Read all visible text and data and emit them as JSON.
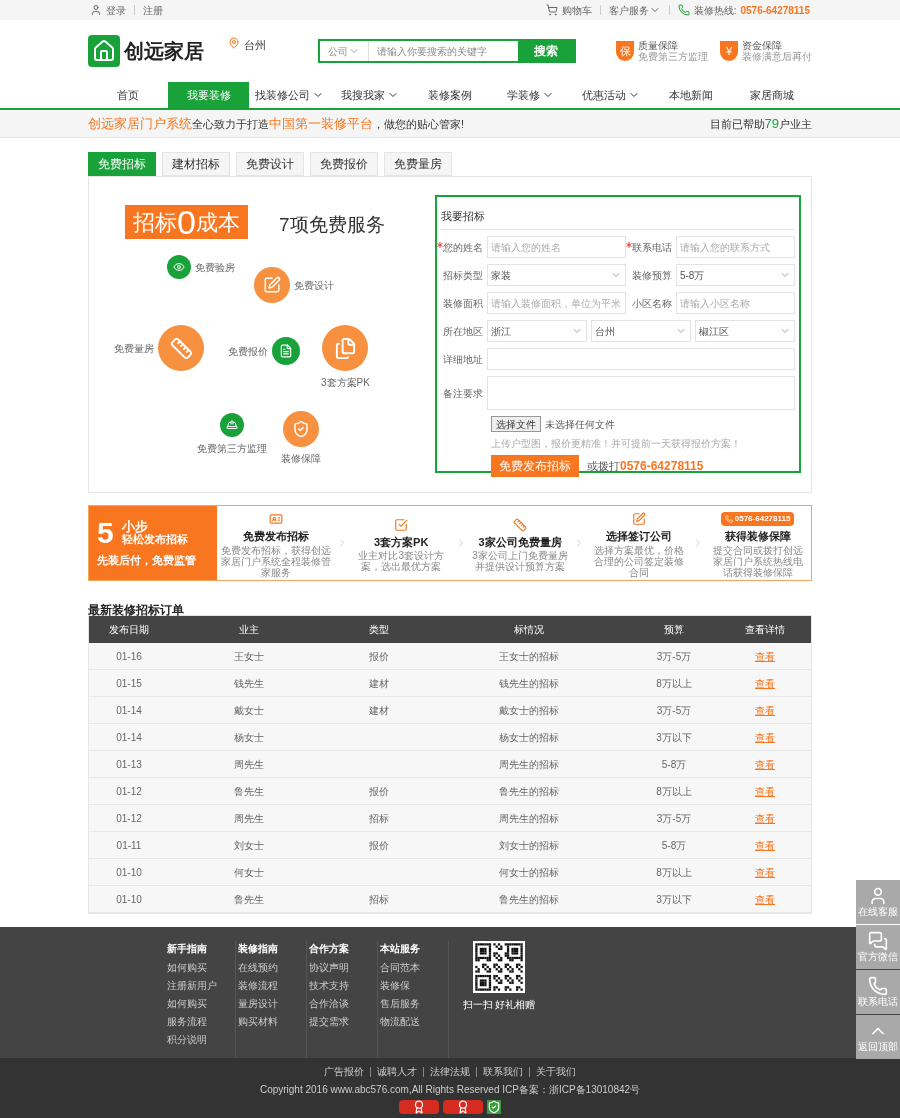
{
  "top_bar": {
    "login": "登录",
    "register": "注册",
    "cart": "购物车",
    "customer_service": "客户服务",
    "hotline_label": "装修热线:",
    "hotline": "0576-64278115"
  },
  "header": {
    "logo": "创远家居",
    "city": "台州",
    "search": {
      "category": "公司",
      "placeholder": "请输入你要搜索的关键字",
      "button": "搜索"
    },
    "guarantees": [
      {
        "badge": "保",
        "title": "质量保障",
        "subtitle": "免费第三方监理"
      },
      {
        "badge": "¥",
        "title": "资金保障",
        "subtitle": "装修满意后再付"
      }
    ]
  },
  "nav": [
    {
      "label": "首页",
      "selected": false,
      "dropdown": false
    },
    {
      "label": "我要装修",
      "selected": true,
      "dropdown": false
    },
    {
      "label": "找装修公司",
      "selected": false,
      "dropdown": true
    },
    {
      "label": "我搜我家",
      "selected": false,
      "dropdown": true
    },
    {
      "label": "装修案例",
      "selected": false,
      "dropdown": false
    },
    {
      "label": "学装修",
      "selected": false,
      "dropdown": true
    },
    {
      "label": "优惠活动",
      "selected": false,
      "dropdown": true
    },
    {
      "label": "本地新闻",
      "selected": false,
      "dropdown": false
    },
    {
      "label": "家居商城",
      "selected": false,
      "dropdown": false
    }
  ],
  "slogan": {
    "segments": [
      {
        "text": "创远家居门户系统",
        "highlight": true
      },
      {
        "text": "全心致力于打造",
        "highlight": false
      },
      {
        "text": "中国第一装修平台",
        "highlight": true
      },
      {
        "text": "，做您的贴心管家!",
        "highlight": false
      }
    ],
    "helped_prefix": "目前已帮助",
    "helped_count": "79",
    "helped_suffix": "户业主"
  },
  "tabs": [
    {
      "label": "免费招标",
      "selected": true
    },
    {
      "label": "建材招标",
      "selected": false
    },
    {
      "label": "免费设计",
      "selected": false
    },
    {
      "label": "免费报价",
      "selected": false
    },
    {
      "label": "免费量房",
      "selected": false
    }
  ],
  "services": {
    "banner_prefix": "招标",
    "banner_zero": "0",
    "banner_suffix": "成本",
    "title": "7项免费服务",
    "items": [
      {
        "label": "免费验房",
        "color": "#1aa23a"
      },
      {
        "label": "免费设计",
        "color": "#f7913f"
      },
      {
        "label": "免费量房",
        "color": "#f7913f"
      },
      {
        "label": "免费报价",
        "color": "#1aa23a"
      },
      {
        "label": "3套方案PK",
        "color": "#f7913f"
      },
      {
        "label": "免费第三方监理",
        "color": "#1aa23a"
      },
      {
        "label": "装修保障",
        "color": "#f7913f"
      }
    ]
  },
  "form": {
    "title": "我要招标",
    "rows": [
      [
        {
          "label": "您的姓名",
          "required": true,
          "kind": "input",
          "placeholder": "请输入您的姓名"
        },
        {
          "label": "联系电话",
          "required": true,
          "kind": "input",
          "placeholder": "请输入您的联系方式"
        }
      ],
      [
        {
          "label": "招标类型",
          "required": false,
          "kind": "select",
          "values": [
            "家装"
          ]
        },
        {
          "label": "装修预算",
          "required": false,
          "kind": "select",
          "values": [
            "5-8万"
          ]
        }
      ],
      [
        {
          "label": "装修面积",
          "required": false,
          "kind": "input",
          "placeholder": "请输入装修面积，单位为平米"
        },
        {
          "label": "小区名称",
          "required": false,
          "kind": "input",
          "placeholder": "请输入小区名称"
        }
      ],
      [
        {
          "label": "所在地区",
          "required": false,
          "kind": "select",
          "values": [
            "浙江",
            "台州",
            "椒江区"
          ]
        }
      ],
      [
        {
          "label": "详细地址",
          "required": false,
          "kind": "input"
        }
      ],
      [
        {
          "label": "备注要求",
          "required": false,
          "kind": "textarea"
        }
      ]
    ],
    "file_button": "选择文件",
    "file_status": "未选择任何文件",
    "hint": "上传户型图，报价更精准！并可提前一天获得报价方案！",
    "submit": "免费发布招标",
    "call_prefix": "或拨打",
    "call_number": "0576-64278115"
  },
  "steps": {
    "number": "5",
    "unit": "小步",
    "subtitle": "轻松发布招标",
    "slogan": "先装后付，免费监管",
    "items": [
      {
        "title": "免费发布招标",
        "desc": "免费发布招标，获得创远家居门户系统全程装修管家服务"
      },
      {
        "title": "3套方案PK",
        "desc": "业主对比3套设计方案，选出最优方案"
      },
      {
        "title": "3家公司免费量房",
        "desc": "3家公司上门免费量房并提供设计预算方案"
      },
      {
        "title": "选择签订公司",
        "desc": "选择方案最优，价格合理的公司签定装修合同"
      },
      {
        "title": "获得装修保障",
        "desc": "提交合同或拨打创远家居门户系统热线电话获得装修保障",
        "badge": "0576-64278115"
      }
    ]
  },
  "orders": {
    "title": "最新装修招标订单",
    "columns": [
      "发布日期",
      "业主",
      "类型",
      "标情况",
      "预算",
      "查看详情"
    ],
    "rows": [
      [
        "01-16",
        "王女士",
        "报价",
        "王女士的招标",
        "3万-5万",
        "查看"
      ],
      [
        "01-15",
        "钱先生",
        "建材",
        "钱先生的招标",
        "8万以上",
        "查看"
      ],
      [
        "01-14",
        "戴女士",
        "建材",
        "戴女士的招标",
        "3万-5万",
        "查看"
      ],
      [
        "01-14",
        "杨女士",
        "",
        "杨女士的招标",
        "3万以下",
        "查看"
      ],
      [
        "01-13",
        "周先生",
        "",
        "周先生的招标",
        "5-8万",
        "查看"
      ],
      [
        "01-12",
        "鲁先生",
        "报价",
        "鲁先生的招标",
        "8万以上",
        "查看"
      ],
      [
        "01-12",
        "周先生",
        "招标",
        "周先生的招标",
        "3万-5万",
        "查看"
      ],
      [
        "01-11",
        "刘女士",
        "报价",
        "刘女士的招标",
        "5-8万",
        "查看"
      ],
      [
        "01-10",
        "何女士",
        "",
        "何女士的招标",
        "8万以上",
        "查看"
      ],
      [
        "01-10",
        "鲁先生",
        "招标",
        "鲁先生的招标",
        "3万以下",
        "查看"
      ]
    ]
  },
  "footer": {
    "columns": [
      {
        "heading": "新手指南",
        "links": [
          "如何购买",
          "注册新用户",
          "如何购买",
          "服务流程",
          "积分说明"
        ]
      },
      {
        "heading": "装修指南",
        "links": [
          "在线预约",
          "装修流程",
          "量房设计",
          "购买材料"
        ]
      },
      {
        "heading": "合作方案",
        "links": [
          "协议声明",
          "技术支持",
          "合作洽谈",
          "提交需求"
        ]
      },
      {
        "heading": "本站服务",
        "links": [
          "合同范本",
          "装修保",
          "售后服务",
          "物流配送"
        ]
      }
    ],
    "qr_caption": "扫一扫 好礼相赠",
    "bottom_links": [
      "广告报价",
      "诚聘人才",
      "法律法规",
      "联系我们",
      "关于我们"
    ],
    "copyright": "Copyright 2016 www.abc576.com,All Rights Reserved ICP备案：浙ICP备13010842号"
  },
  "side_buttons": [
    "在线客服",
    "官方微信",
    "联系电话",
    "返回顶部"
  ]
}
